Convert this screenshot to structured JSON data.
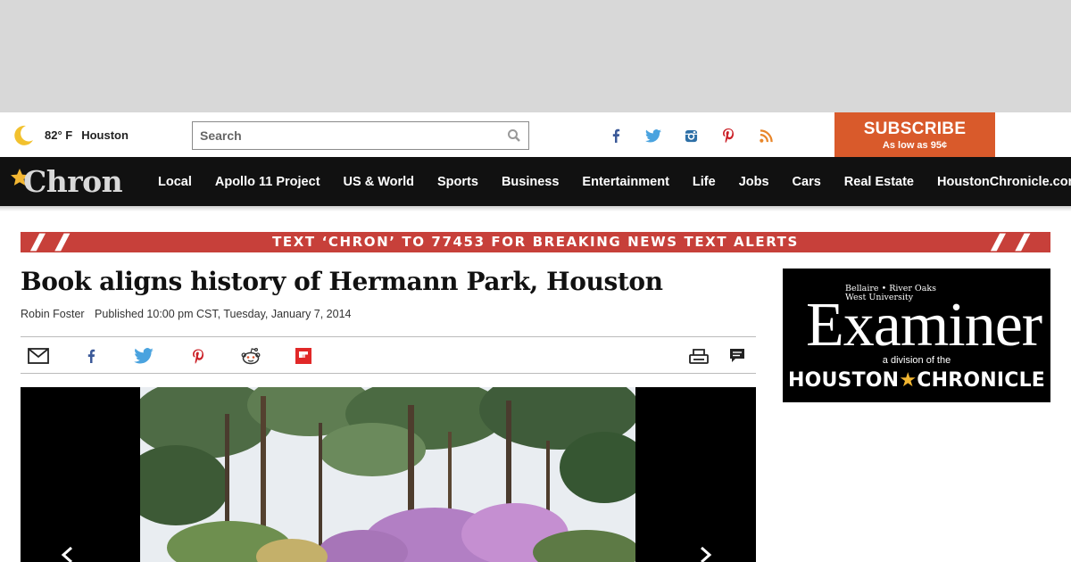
{
  "weather": {
    "temp": "82° F",
    "city": "Houston"
  },
  "search": {
    "placeholder": "Search"
  },
  "subscribe": {
    "label": "SUBSCRIBE",
    "sub": "As low as 95¢"
  },
  "brand": {
    "logo": "Chron"
  },
  "nav": [
    "Local",
    "Apollo 11 Project",
    "US & World",
    "Sports",
    "Business",
    "Entertainment",
    "Life",
    "Jobs",
    "Cars",
    "Real Estate",
    "HoustonChronicle.com"
  ],
  "alert": {
    "text": "TEXT ‘CHRON’ TO 77453 FOR BREAKING NEWS TEXT ALERTS"
  },
  "article": {
    "title": "Book aligns history of Hermann Park, Houston",
    "author": "Robin Foster",
    "published": "Published 10:00 pm CST, Tuesday, January 7, 2014"
  },
  "ad": {
    "locations_line1": "Bellaire • River Oaks",
    "locations_line2": "West University",
    "name": "Examiner",
    "division": "a division of the",
    "parent_left": "HOUSTON",
    "parent_right": "CHRONICLE"
  },
  "colors": {
    "subscribe": "#d95a2b",
    "nav_bg": "#111111",
    "alert": "#c7403a",
    "moon": "#f2c12e"
  }
}
